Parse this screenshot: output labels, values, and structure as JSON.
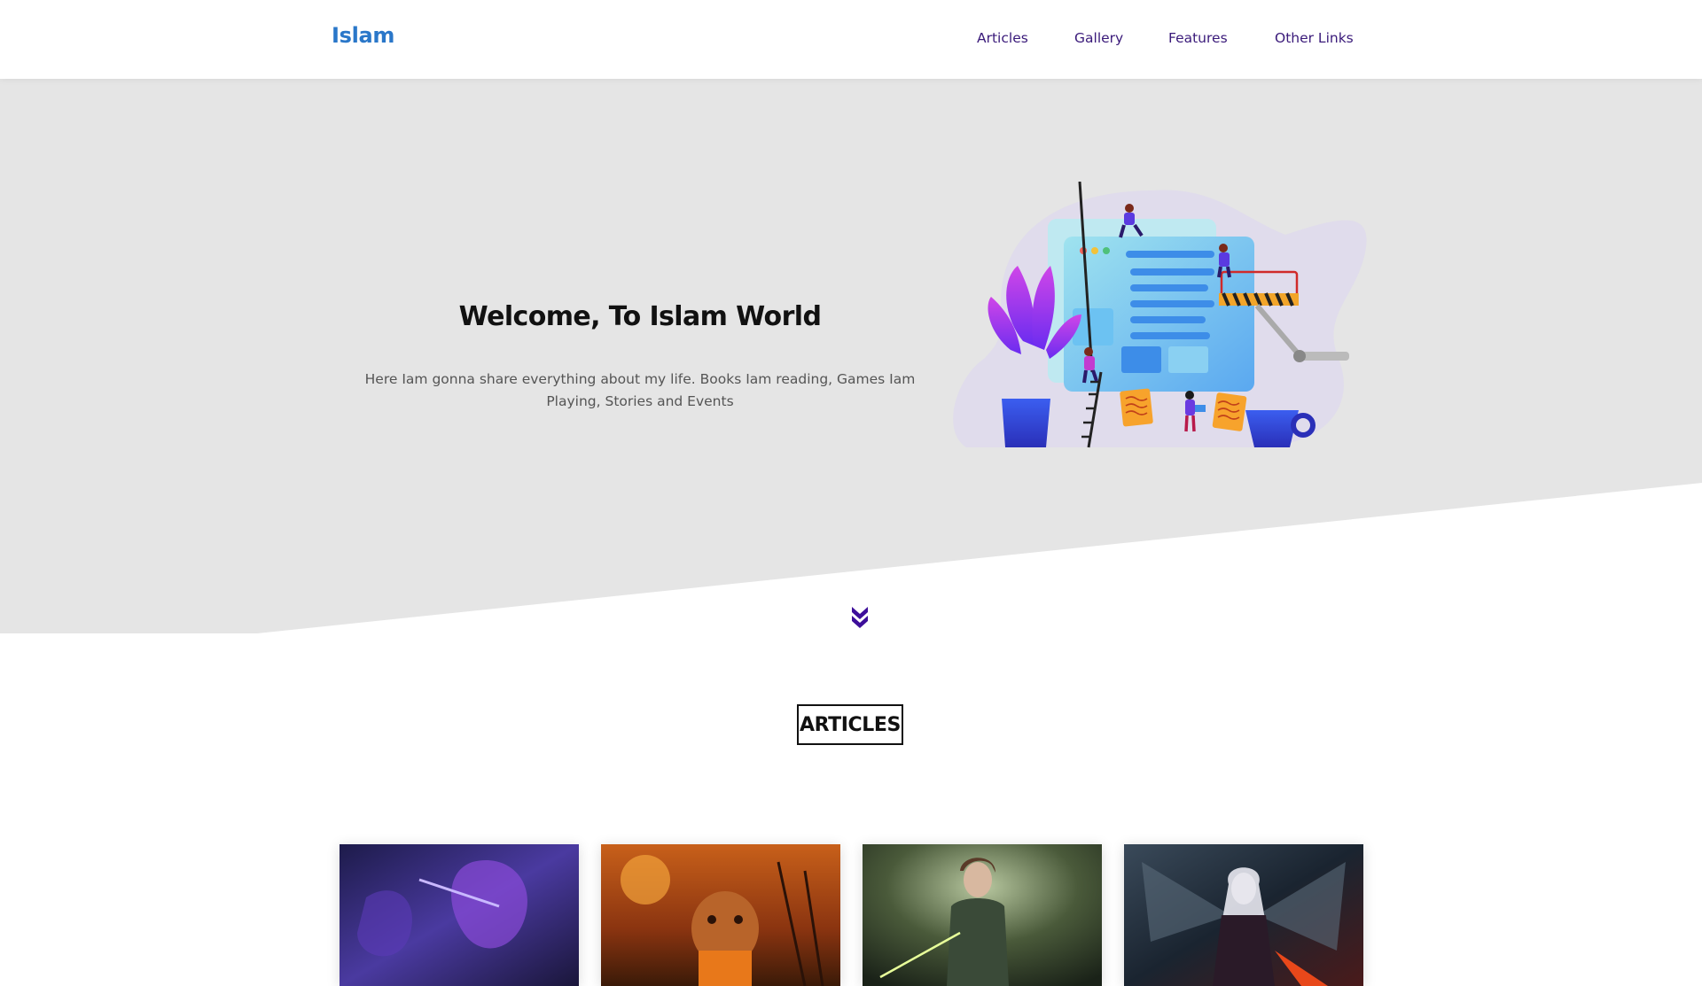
{
  "header": {
    "logo": "Islam",
    "nav": [
      "Articles",
      "Gallery",
      "Features",
      "Other Links"
    ]
  },
  "landing": {
    "title": "Welcome, To Islam World",
    "description": "Here Iam gonna share everything about my life. Books Iam reading, Games Iam Playing, Stories and Events",
    "illustration_icon": "web-development-illustration",
    "scroll_icon": "double-chevron-down-icon"
  },
  "articles": {
    "title": "ARTICLES",
    "cards": [
      {
        "image": "purple-armored-warrior-artwork"
      },
      {
        "image": "orange-bear-character-artwork"
      },
      {
        "image": "forest-heroine-artwork"
      },
      {
        "image": "winged-demon-warrior-artwork"
      }
    ]
  },
  "colors": {
    "brand": "#2a77c9",
    "nav_text": "#3a1a7a",
    "landing_bg": "#e5e5e5",
    "accent": "#3d0e9a"
  }
}
